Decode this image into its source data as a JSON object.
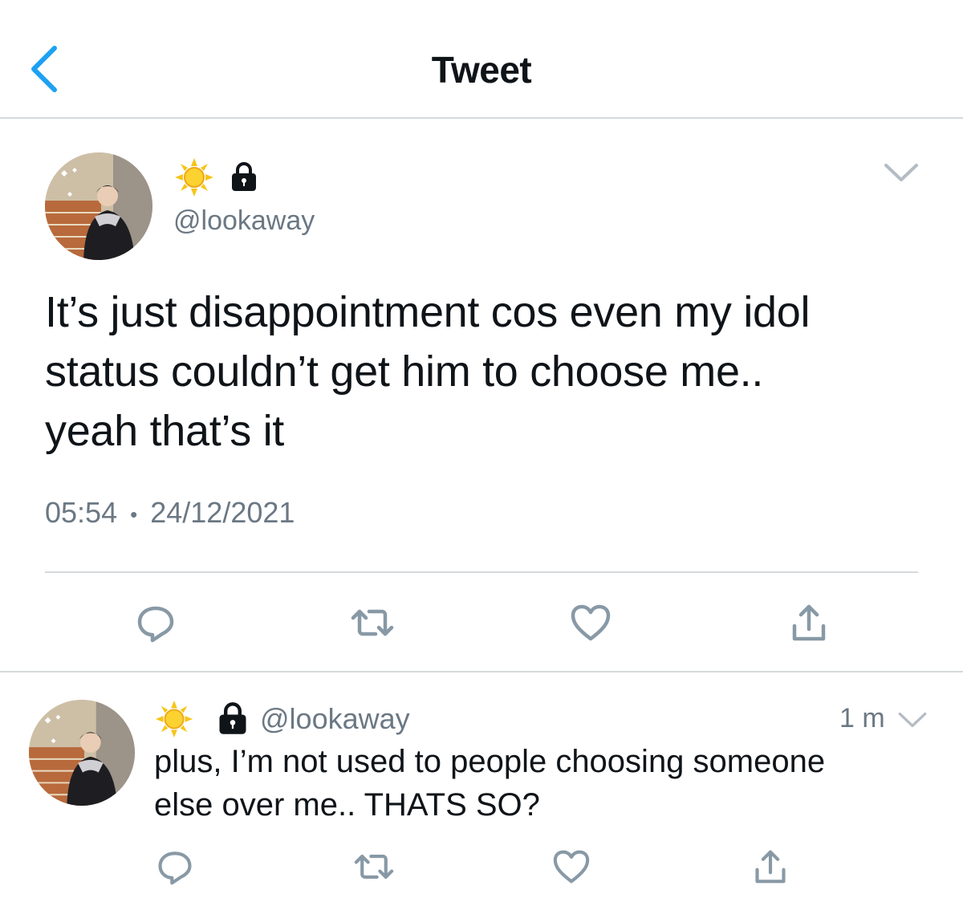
{
  "header": {
    "title": "Tweet"
  },
  "tweet": {
    "handle": "@lookaway",
    "text_lines": [
      "It’s just disappointment cos even my idol",
      "status couldn’t get him to choose me..",
      "yeah that’s it"
    ],
    "time": "05:54",
    "separator": "•",
    "date": "24/12/2021"
  },
  "reply": {
    "handle": "@lookaway",
    "age": "1 m",
    "text_lines": [
      "plus, I’m not used to people choosing someone",
      "else over me.. THATS SO?"
    ]
  },
  "icons": [
    "back-icon",
    "sun-emoji-icon",
    "lock-icon",
    "chevron-down-icon",
    "reply-icon",
    "retweet-icon",
    "like-icon",
    "share-icon"
  ],
  "colors": {
    "accent": "#1da1f2",
    "secondary_text": "#6b7884",
    "divider": "#d6d9dc",
    "icon": "#8899a6"
  }
}
